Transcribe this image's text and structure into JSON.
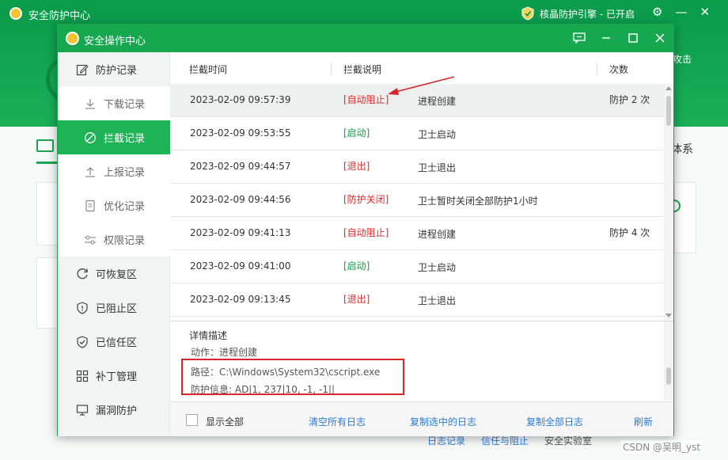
{
  "background": {
    "app_title": "安全防护中心",
    "engine_status": "核晶防护引擎 - 已开启",
    "side_text": "攻击",
    "right_tab": "体系",
    "footer_links": [
      "日志记录",
      "信任与阻止",
      "安全实验室"
    ],
    "watermark": "CSDN @吴明_yst"
  },
  "dialog": {
    "title": "安全操作中心",
    "sidebar": [
      {
        "label": "防护记录",
        "icon": "note-edit-icon",
        "level": "top"
      },
      {
        "label": "下载记录",
        "icon": "download-icon",
        "level": "sub"
      },
      {
        "label": "拦截记录",
        "icon": "block-icon",
        "level": "sub",
        "active": true
      },
      {
        "label": "上报记录",
        "icon": "upload-icon",
        "level": "sub"
      },
      {
        "label": "优化记录",
        "icon": "doc-icon",
        "level": "sub"
      },
      {
        "label": "权限记录",
        "icon": "sliders-icon",
        "level": "sub"
      },
      {
        "label": "可恢复区",
        "icon": "restore-icon",
        "level": "top"
      },
      {
        "label": "已阻止区",
        "icon": "shield-alert-icon",
        "level": "top"
      },
      {
        "label": "已信任区",
        "icon": "shield-check-icon",
        "level": "top"
      },
      {
        "label": "补丁管理",
        "icon": "grid-icon",
        "level": "top"
      },
      {
        "label": "漏洞防护",
        "icon": "monitor-icon",
        "level": "top"
      }
    ],
    "table": {
      "headers": [
        "拦截时间",
        "拦截说明",
        "次数"
      ],
      "rows": [
        {
          "time": "2023-02-09 09:57:39",
          "tag": "[自动阻止]",
          "tag_color": "red",
          "desc": "进程创建",
          "count": "防护 2 次",
          "selected": true
        },
        {
          "time": "2023-02-09 09:53:55",
          "tag": "[启动]",
          "tag_color": "green",
          "desc": "卫士启动",
          "count": ""
        },
        {
          "time": "2023-02-09 09:44:57",
          "tag": "[退出]",
          "tag_color": "red",
          "desc": "卫士退出",
          "count": ""
        },
        {
          "time": "2023-02-09 09:44:56",
          "tag": "[防护关闭]",
          "tag_color": "red",
          "desc": "卫士暂时关闭全部防护1小时",
          "count": ""
        },
        {
          "time": "2023-02-09 09:41:13",
          "tag": "[自动阻止]",
          "tag_color": "red",
          "desc": "进程创建",
          "count": "防护 4 次"
        },
        {
          "time": "2023-02-09 09:41:00",
          "tag": "[启动]",
          "tag_color": "green",
          "desc": "卫士启动",
          "count": ""
        },
        {
          "time": "2023-02-09 09:13:45",
          "tag": "[退出]",
          "tag_color": "red",
          "desc": "卫士退出",
          "count": ""
        }
      ]
    },
    "detail": {
      "title": "详情描述",
      "action": "动作：进程创建",
      "path": "路径：C:\\Windows\\System32\\cscript.exe",
      "info": "防护信息: AD|1, 237|10, -1, -1||"
    },
    "footer": {
      "show_all": "显示全部",
      "clear_logs": "清空所有日志",
      "copy_selected": "复制选中的日志",
      "copy_all": "复制全部日志",
      "refresh": "刷新"
    }
  },
  "colors": {
    "brand_green": "#17a84f",
    "active_green": "#1db356",
    "tag_red": "#d92b2b",
    "tag_green": "#1a9a44",
    "link_blue": "#2c7bd8",
    "annotation_red": "#d8262a"
  }
}
